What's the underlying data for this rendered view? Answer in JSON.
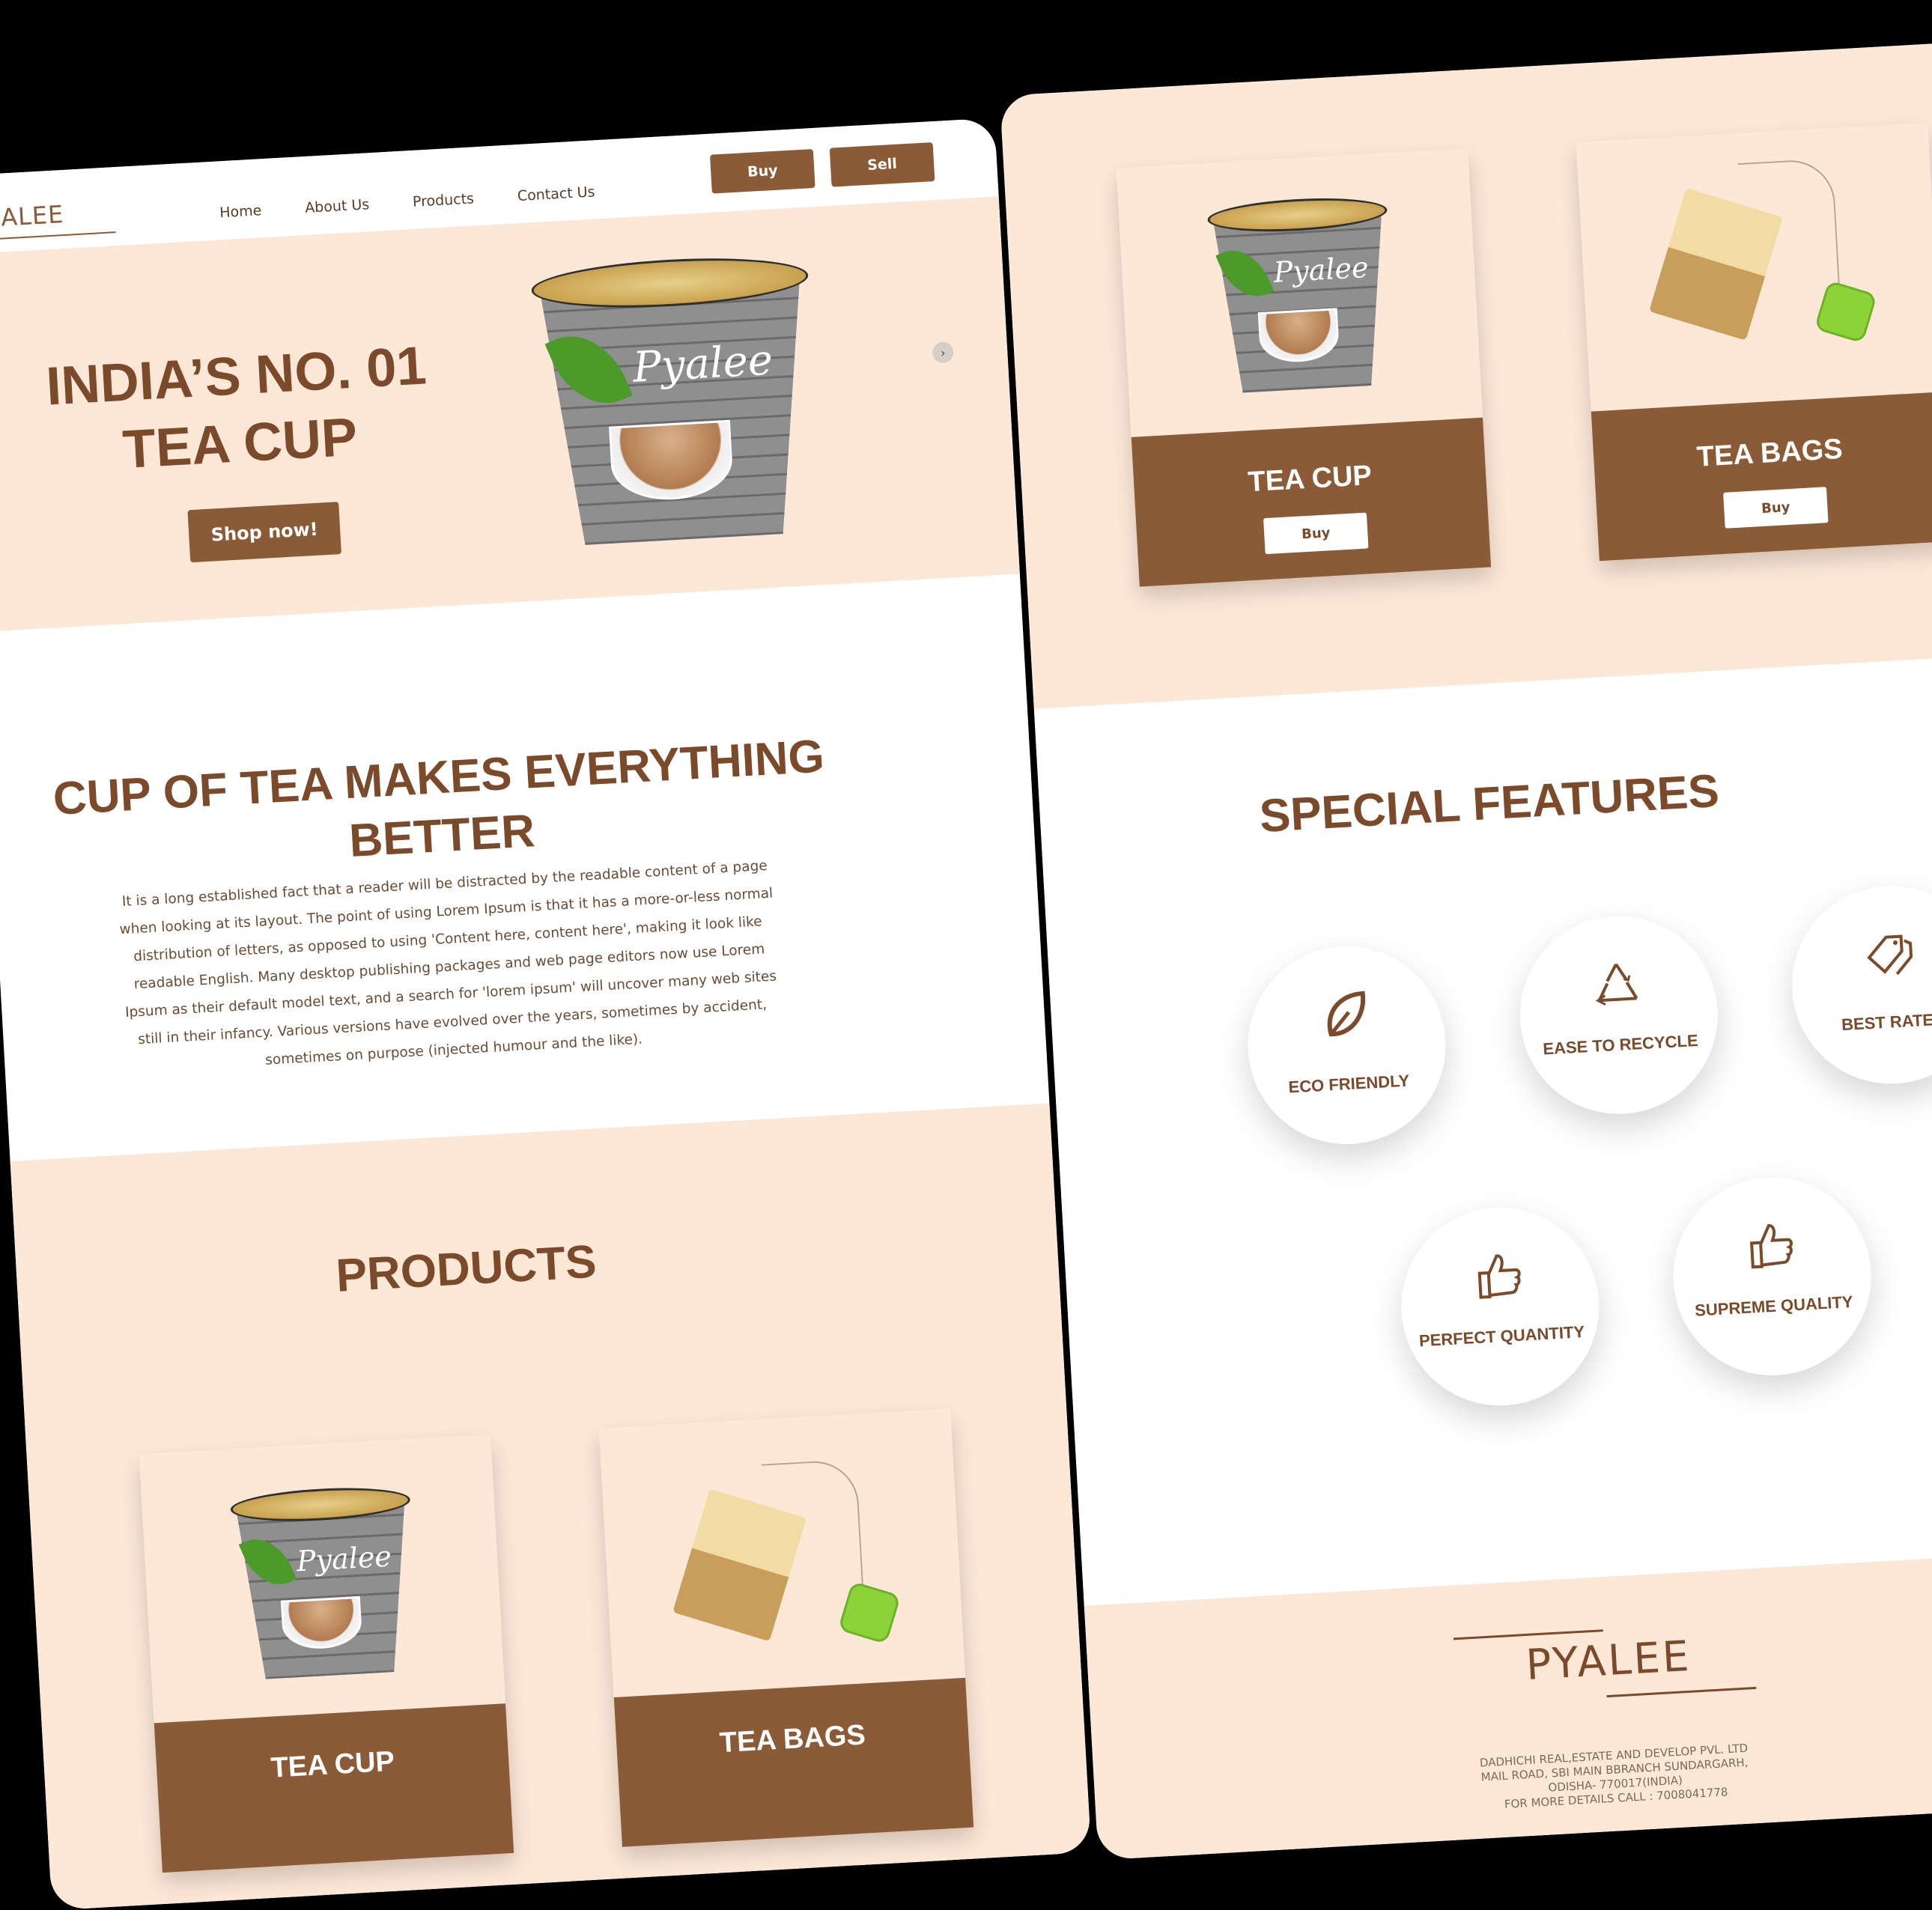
{
  "nav": {
    "logo": "ALEE",
    "links": [
      "Home",
      "About Us",
      "Products",
      "Contact Us"
    ],
    "buy_label": "Buy",
    "sell_label": "Sell"
  },
  "hero": {
    "title_line1": "INDIA’S NO. 01",
    "title_line2": "TEA CUP",
    "shop_label": "Shop now!",
    "next_icon": "›",
    "cup_brand": "Pyalee"
  },
  "about": {
    "title_line1": "CUP OF TEA MAKES EVERYTHING",
    "title_line2": "BETTER",
    "paragraph": "It is a long established fact that a reader will be distracted by the readable content of a page when looking at its layout. The point of using Lorem Ipsum is that it has a more-or-less normal distribution of letters, as opposed to using 'Content here, content here', making it look like readable English. Many desktop publishing packages and web page editors now use Lorem Ipsum as their default model text, and a search for 'lorem ipsum' will uncover many web sites still in their infancy. Various versions have evolved over the years, sometimes by accident, sometimes on purpose (injected humour and the like)."
  },
  "products": {
    "title": "PRODUCTS",
    "items": [
      {
        "name": "TEA CUP",
        "button": "Buy"
      },
      {
        "name": "TEA BAGS",
        "button": "Buy"
      }
    ]
  },
  "features": {
    "title": "SPECIAL FEATURES",
    "items": [
      {
        "label": "ECO FRIENDLY",
        "icon": "leaf-icon"
      },
      {
        "label": "EASE TO RECYCLE",
        "icon": "recycle-icon"
      },
      {
        "label": "BEST RATES",
        "icon": "price-tag-icon"
      },
      {
        "label": "PERFECT QUANTITY",
        "icon": "thumbs-up-icon"
      },
      {
        "label": "SUPREME QUALITY",
        "icon": "thumbs-up-icon"
      }
    ]
  },
  "footer": {
    "logo": "PYALEE",
    "address_line1": "DADHICHI REAL,ESTATE AND DEVELOP PVL. LTD",
    "address_line2": "MAIL ROAD, SBI MAIN BBRANCH SUNDARGARH,",
    "address_line3": "ODISHA- 770017(INDIA)",
    "address_line4": "FOR MORE DETAILS CALL : 7008041778"
  },
  "colors": {
    "accent": "#8b5a36",
    "text_brown": "#7a4a2a",
    "peach_bg": "#fde8d8",
    "tag_green": "#8cd33a"
  }
}
